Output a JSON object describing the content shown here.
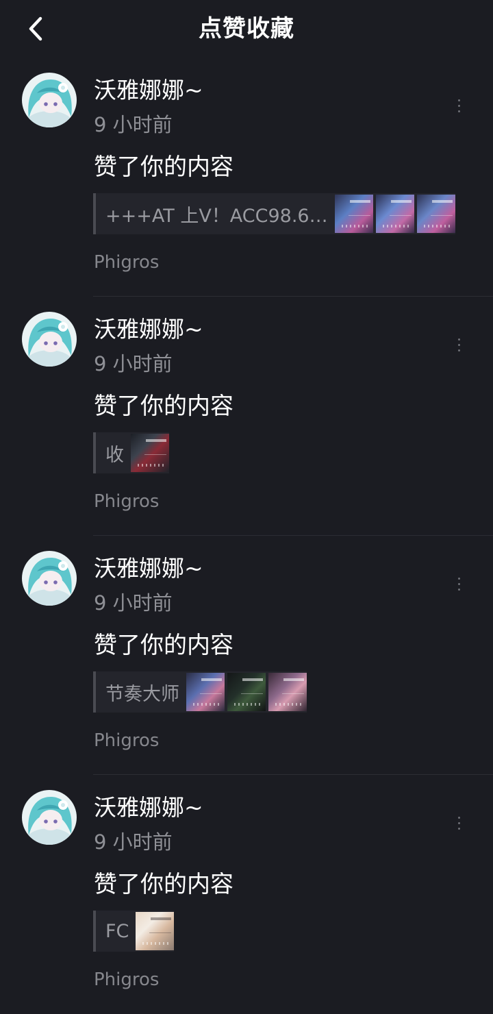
{
  "header": {
    "title": "点赞收藏",
    "back_icon": "chevron-left-icon"
  },
  "colors": {
    "background": "#1b1c22",
    "primary_text": "#ffffff",
    "secondary_text": "#8f9096",
    "card_background": "#24252c"
  },
  "notifications": [
    {
      "username": "沃雅娜娜~",
      "time": "9 小时前",
      "action": "赞了你的内容",
      "ref_text": "+++AT 上V！ACC98.6…",
      "thumbnail_count": 3,
      "source": "Phigros"
    },
    {
      "username": "沃雅娜娜~",
      "time": "9 小时前",
      "action": "赞了你的内容",
      "ref_text": "收",
      "thumbnail_count": 1,
      "source": "Phigros"
    },
    {
      "username": "沃雅娜娜~",
      "time": "9 小时前",
      "action": "赞了你的内容",
      "ref_text": "节奏大师",
      "thumbnail_count": 3,
      "source": "Phigros"
    },
    {
      "username": "沃雅娜娜~",
      "time": "9 小时前",
      "action": "赞了你的内容",
      "ref_text": "FC",
      "thumbnail_count": 1,
      "source": "Phigros"
    }
  ]
}
